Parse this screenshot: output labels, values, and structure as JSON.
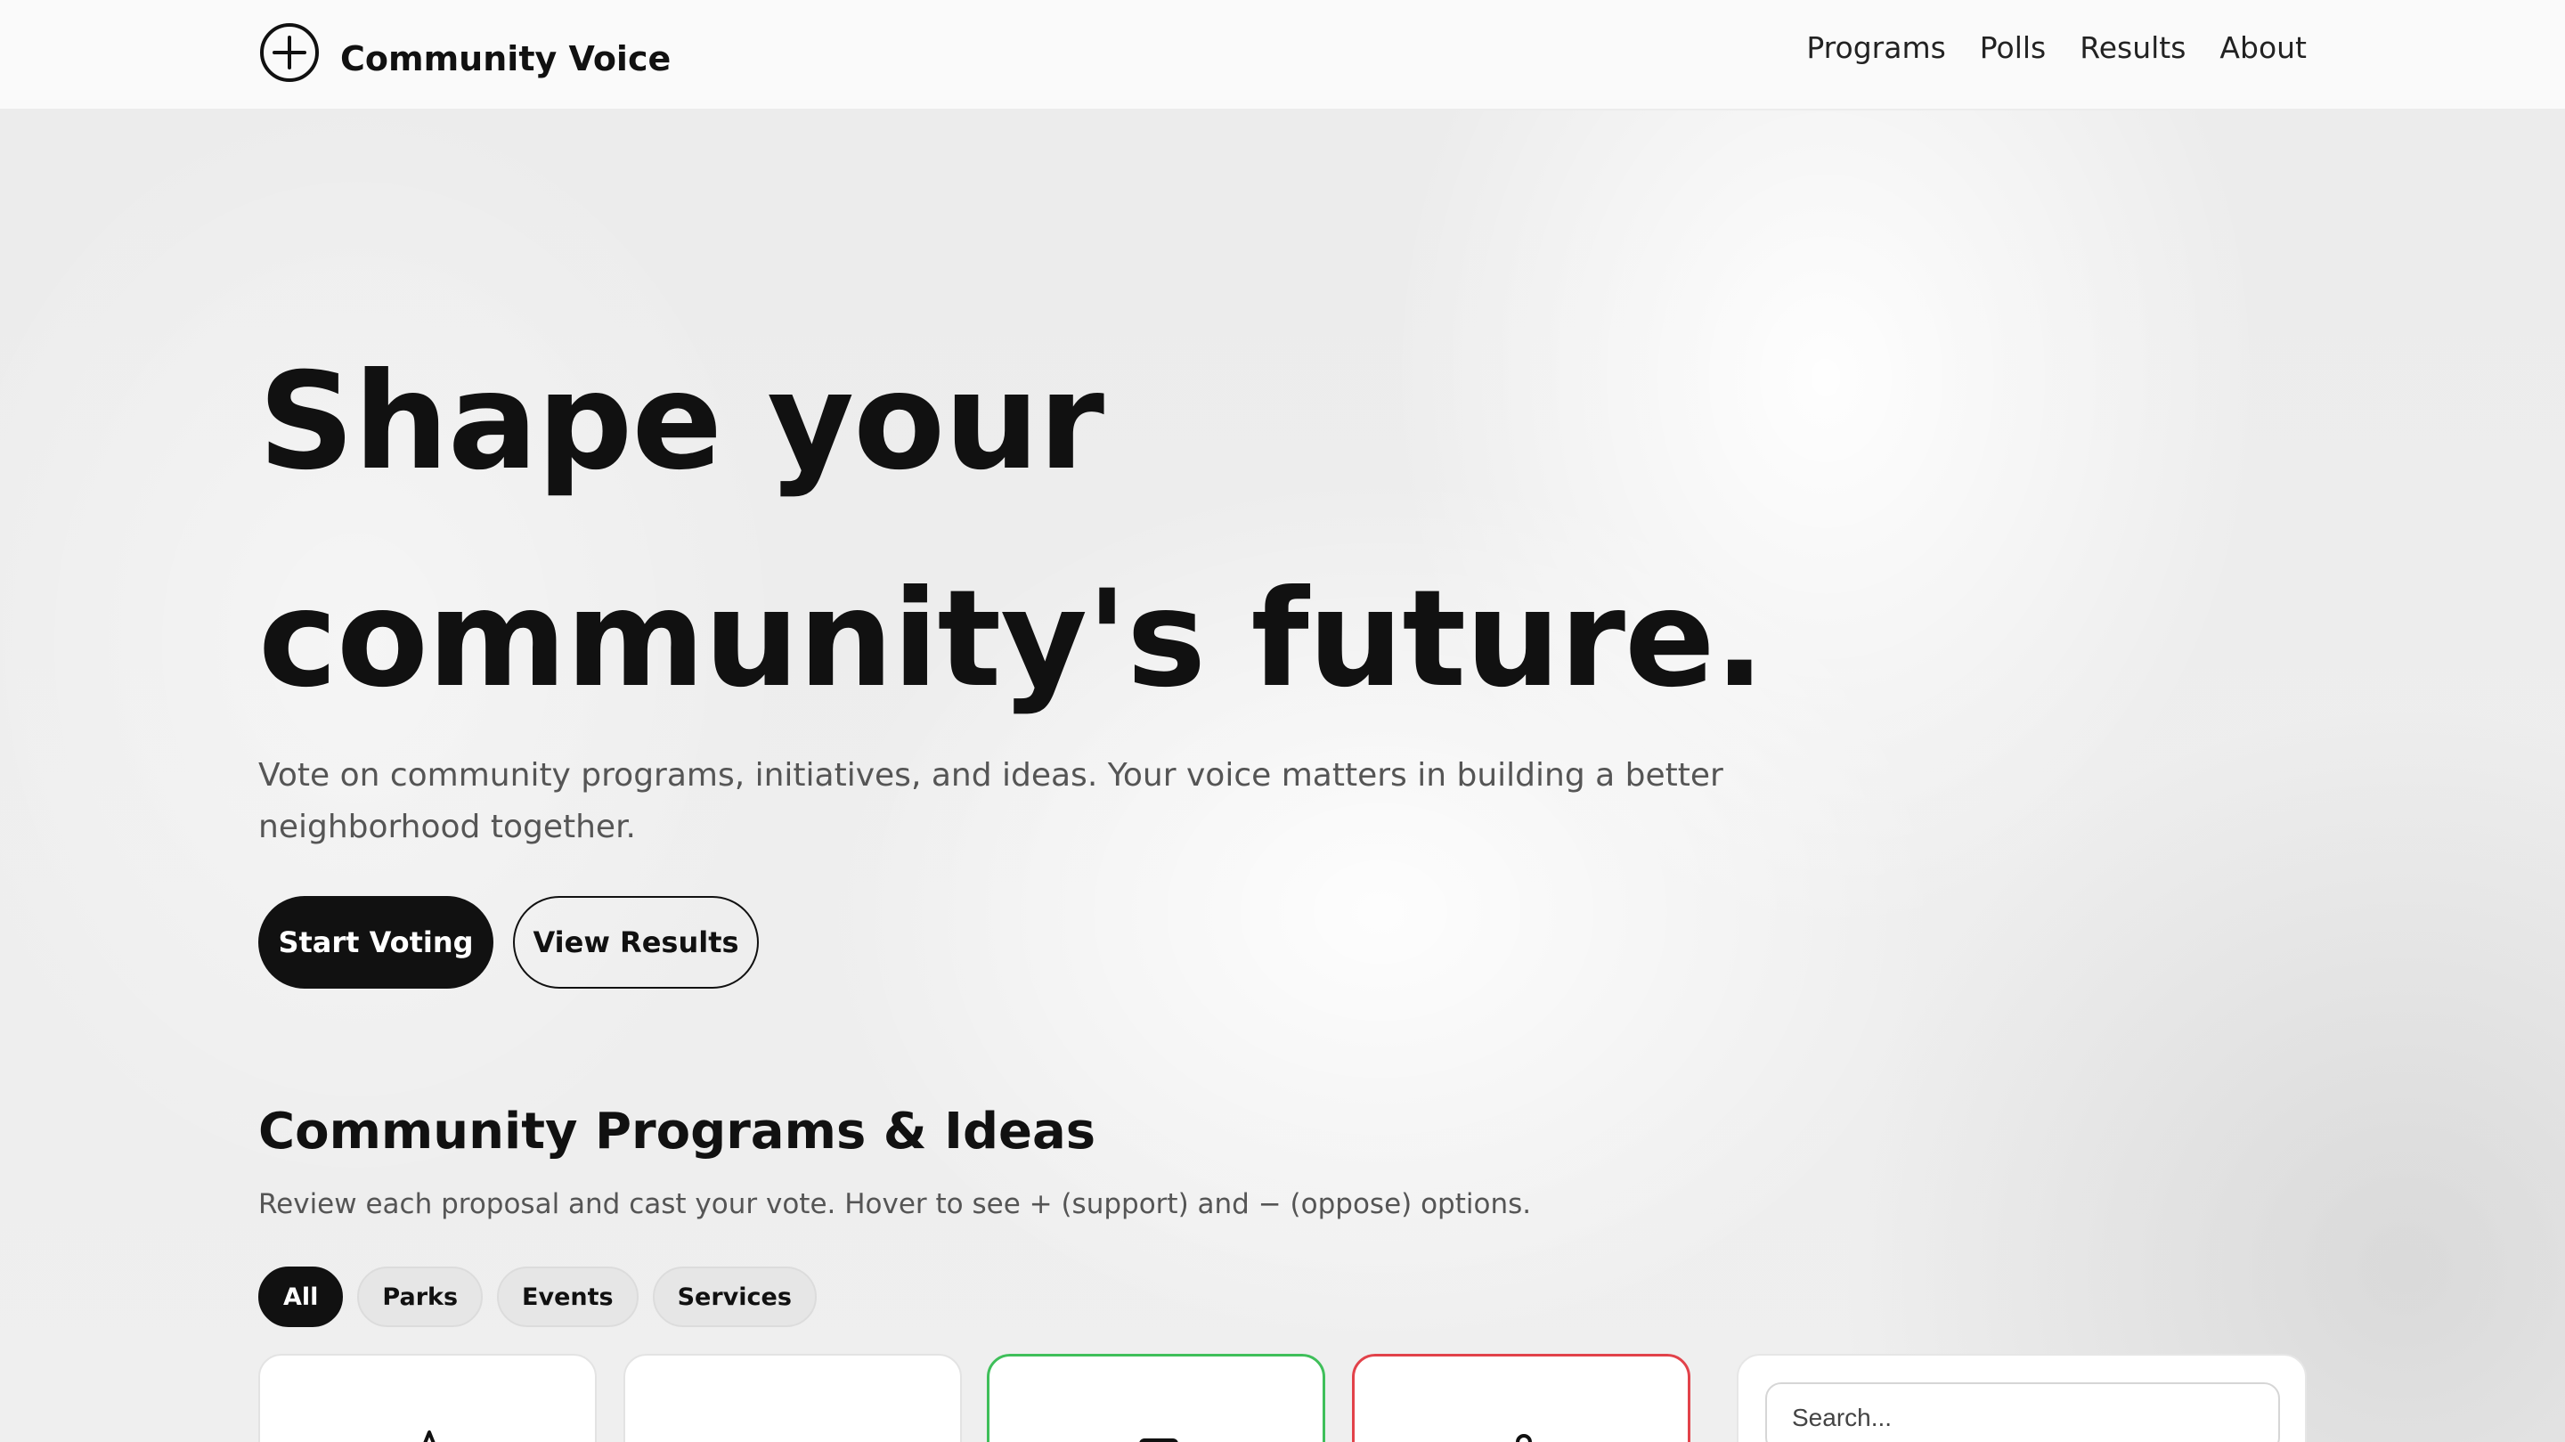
{
  "brand": {
    "name": "Community Voice",
    "logo_icon": "plus-circle-icon"
  },
  "nav": {
    "items": [
      "Programs",
      "Polls",
      "Results",
      "About"
    ]
  },
  "hero": {
    "title_line1": "Shape your",
    "title_line2": "community's future.",
    "subtitle": "Vote on community programs, initiatives, and ideas. Your voice matters in building a better neighborhood together.",
    "primary_button": "Start Voting",
    "secondary_button": "View Results"
  },
  "programs": {
    "title": "Community Programs & Ideas",
    "subtitle": "Review each proposal and cast your vote. Hover to see + (support) and − (oppose) options.",
    "filters": [
      "All",
      "Parks",
      "Events",
      "Services"
    ],
    "active_filter": "All",
    "cards": [
      {
        "icon": "tree-icon",
        "state": "neutral"
      },
      {
        "icon": "none",
        "state": "neutral"
      },
      {
        "icon": "card-icon",
        "state": "support",
        "border_color": "#3fbf5a"
      },
      {
        "icon": "person-icon",
        "state": "oppose",
        "border_color": "#e2424a"
      }
    ]
  },
  "sidebar": {
    "search_placeholder": "Search..."
  },
  "colors": {
    "accent": "#111111",
    "support": "#3fbf5a",
    "oppose": "#e2424a",
    "muted_text": "#555555"
  }
}
